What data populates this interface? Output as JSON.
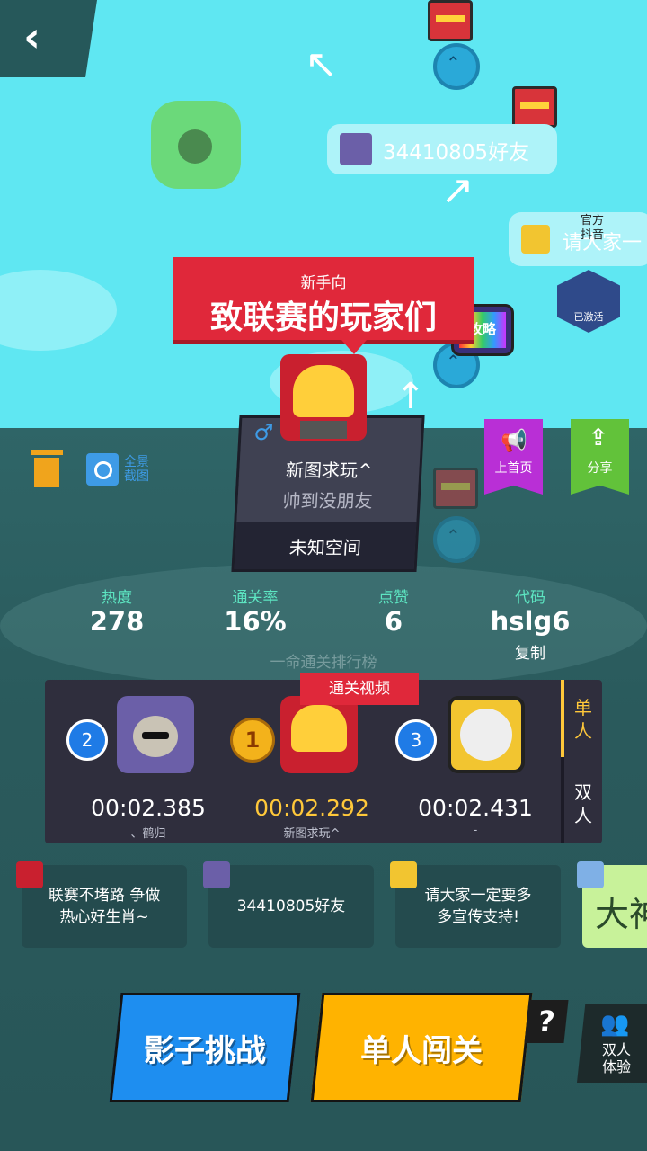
{
  "map": {
    "friend_bubble": "34410805好友",
    "official_bubble_text": "请大家一",
    "official_label": "官方\n抖音",
    "activated_label": "已激活",
    "guide_tv": "攻略"
  },
  "banner": {
    "subtitle": "新手向",
    "title": "致联赛的玩家们"
  },
  "toolbar": {
    "panorama_label": "全景\n截图",
    "homepage_label": "上首页",
    "share_label": "分享"
  },
  "level_card": {
    "author": "新图求玩^",
    "slogan": "帅到没朋友",
    "location": "未知空间"
  },
  "stats": [
    {
      "label": "热度",
      "value": "278"
    },
    {
      "label": "通关率",
      "value": "16%"
    },
    {
      "label": "点赞",
      "value": "6"
    },
    {
      "label": "代码",
      "value": "hslg6",
      "extra": "复制"
    }
  ],
  "leaderboard": {
    "title": "一命通关排行榜",
    "video_badge": "通关视频",
    "tabs": [
      "单人",
      "双人"
    ],
    "entries": [
      {
        "rank": "2",
        "time": "00:02.385",
        "name": "、鹤归"
      },
      {
        "rank": "1",
        "time": "00:02.292",
        "name": "新图求玩^"
      },
      {
        "rank": "3",
        "time": "00:02.431",
        "name": "-"
      }
    ]
  },
  "comments": [
    {
      "text": "联赛不堵路 争做\n热心好生肖~"
    },
    {
      "text": "34410805好友"
    },
    {
      "text": "请大家一定要多\n多宣传支持!"
    },
    {
      "text": "大神"
    }
  ],
  "buttons": {
    "shadow_challenge": "影子挑战",
    "single_play": "单人闯关",
    "help": "?",
    "duo_trial": "双人\n体验"
  },
  "colors": {
    "sky": "#5fe7f2",
    "ground": "#2b5c5e",
    "banner_red": "#e0283a",
    "shadow_btn_blue": "#1e8ef0",
    "single_btn_yellow": "#ffb300",
    "homepage_purple": "#b92fd6",
    "share_green": "#62c23a",
    "stat_label_teal": "#5de6c2",
    "gold_time": "#ffc83a"
  }
}
